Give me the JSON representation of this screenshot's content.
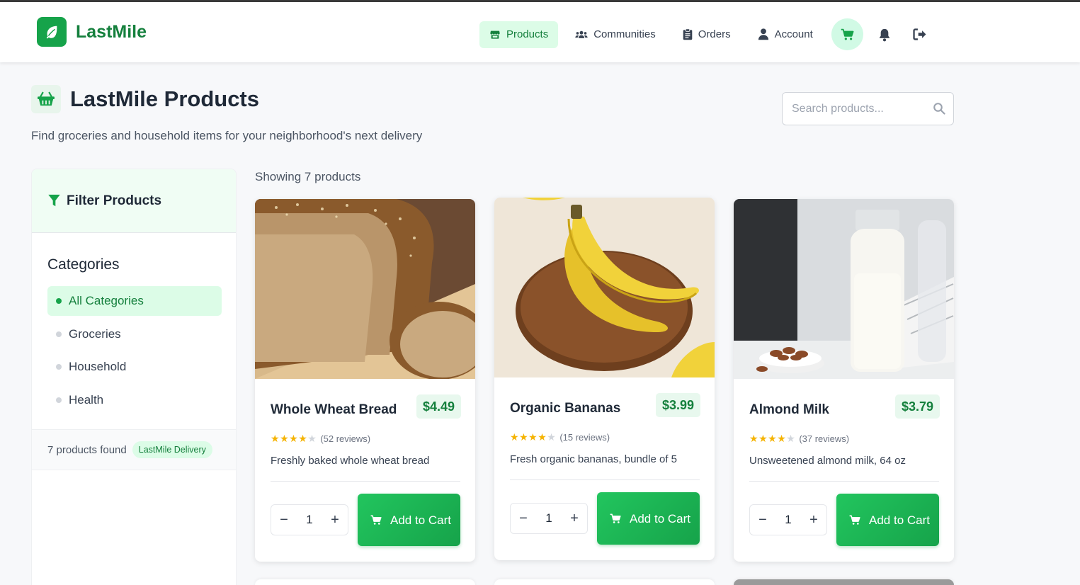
{
  "brand": {
    "name": "LastMile"
  },
  "nav": {
    "items": [
      {
        "label": "Products",
        "icon": "store-icon"
      },
      {
        "label": "Communities",
        "icon": "users-icon"
      },
      {
        "label": "Orders",
        "icon": "clipboard-icon"
      },
      {
        "label": "Account",
        "icon": "user-icon"
      }
    ],
    "active": "Products",
    "icons": [
      "cart-icon",
      "bell-icon",
      "logout-icon"
    ]
  },
  "header": {
    "title": "LastMile Products",
    "subtitle": "Find groceries and household items for your neighborhood's next delivery"
  },
  "search": {
    "placeholder": "Search products..."
  },
  "sidebar": {
    "title": "Filter Products",
    "categories_title": "Categories",
    "categories": [
      {
        "label": "All Categories",
        "active": true
      },
      {
        "label": "Groceries",
        "active": false
      },
      {
        "label": "Household",
        "active": false
      },
      {
        "label": "Health",
        "active": false
      }
    ],
    "found_text": "7 products found",
    "badge": "LastMile Delivery"
  },
  "results": {
    "showing": "Showing 7 products"
  },
  "products": [
    {
      "name": "Whole Wheat Bread",
      "price": "$4.49",
      "rating": 4,
      "reviews": "(52 reviews)",
      "description": "Freshly baked whole wheat bread",
      "quantity": "1",
      "button": "Add to Cart"
    },
    {
      "name": "Organic Bananas",
      "price": "$3.99",
      "rating": 4,
      "reviews": "(15 reviews)",
      "description": "Fresh organic bananas, bundle of 5",
      "quantity": "1",
      "button": "Add to Cart"
    },
    {
      "name": "Almond Milk",
      "price": "$3.79",
      "rating": 4,
      "reviews": "(37 reviews)",
      "description": "Unsweetened almond milk, 64 oz",
      "quantity": "1",
      "button": "Add to Cart"
    }
  ],
  "colors": {
    "brand": "#16a34a",
    "brand_dark": "#15803d",
    "accent_light": "#dcfce7",
    "star": "#f5b301"
  }
}
